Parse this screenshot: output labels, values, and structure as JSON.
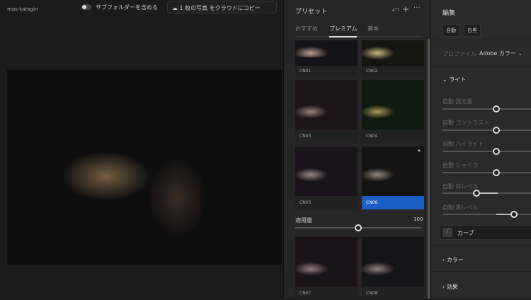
{
  "topbar": {
    "user": "mas-katagiri",
    "include_subfolders": "サブフォルダーを含める",
    "copy_button": "1 枚の写真 をクラウドにコピー"
  },
  "presets": {
    "title": "プリセット",
    "tabs": [
      "おすすめ",
      "プレミアム",
      "基本"
    ],
    "active_tab": "プレミアム",
    "items": [
      "CN01",
      "CN02",
      "CN03",
      "CN04",
      "CN05",
      "CN06",
      "CN07",
      "CN08"
    ],
    "selected": "CN06",
    "amount_label": "適用量",
    "amount_value": "100"
  },
  "edit": {
    "title": "編集",
    "auto_button": "自動",
    "bw_button": "白黒",
    "profile_label": "プロファイル",
    "profile_value": "Adobe カラー",
    "light": "ライト",
    "sliders": [
      {
        "label": "自動 露光量",
        "value": 0.5
      },
      {
        "label": "自動 コントラスト",
        "value": 0.5
      },
      {
        "label": "自動 ハイライト",
        "value": 0.5
      },
      {
        "label": "自動 シャドウ",
        "value": 0.5
      },
      {
        "label": "自動 白レベル",
        "value": 0.3
      },
      {
        "label": "自動 黒レベル",
        "value": 0.67
      }
    ],
    "curve": "カーブ",
    "color": "カラー",
    "effects": "効果"
  }
}
